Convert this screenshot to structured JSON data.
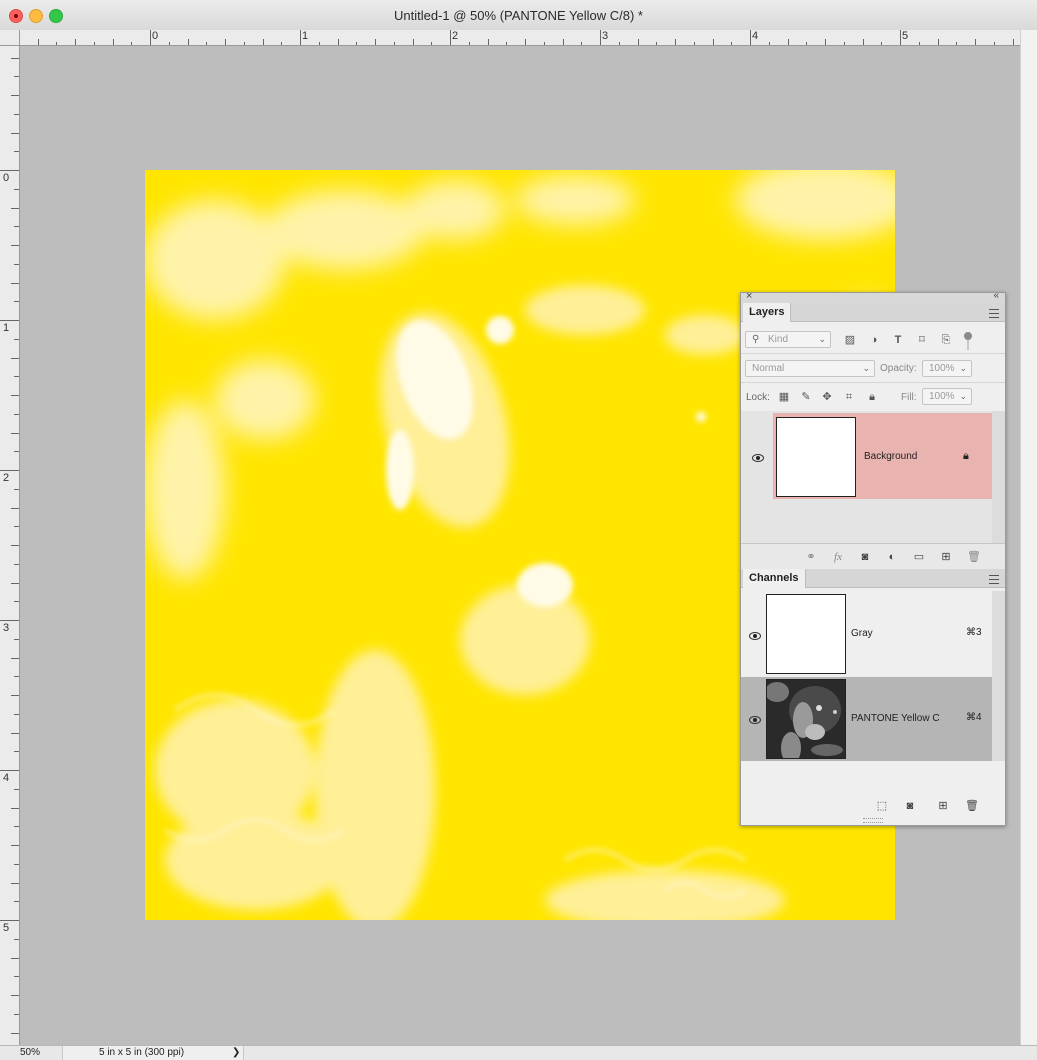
{
  "window": {
    "title": "Untitled-1 @ 50% (PANTONE Yellow C/8) *"
  },
  "rulers": {
    "horizontal_labels": [
      "0",
      "1",
      "2",
      "3",
      "4",
      "5"
    ],
    "vertical_labels": [
      "0",
      "1",
      "2",
      "3",
      "4",
      "5"
    ]
  },
  "canvas": {
    "ink_color": "#ffe500",
    "paper_color": "#fff8d4"
  },
  "status_bar": {
    "zoom": "50%",
    "document_size": "5 in x 5 in (300 ppi)",
    "menu_arrow": "❯"
  },
  "layers_panel": {
    "tab_label": "Layers",
    "filter_kind": "Kind",
    "blend_mode": "Normal",
    "opacity_label": "Opacity:",
    "opacity_value": "100%",
    "lock_label": "Lock:",
    "fill_label": "Fill:",
    "fill_value": "100%",
    "layers": [
      {
        "name": "Background",
        "visible": true,
        "locked": true,
        "selected": true
      }
    ],
    "footer_icons": [
      "link-icon",
      "fx-icon",
      "mask-icon",
      "adjustment-icon",
      "folder-icon",
      "new-layer-icon",
      "trash-icon"
    ],
    "fx_label": "fx"
  },
  "channels_panel": {
    "tab_label": "Channels",
    "channels": [
      {
        "name": "Gray",
        "shortcut": "⌘3",
        "visible": true,
        "selected": false
      },
      {
        "name": "PANTONE Yellow C",
        "shortcut": "⌘4",
        "visible": true,
        "selected": true
      }
    ],
    "footer_icons": [
      "selection-icon",
      "mask-icon",
      "new-channel-icon",
      "trash-icon"
    ]
  },
  "colors": {
    "selected_layer_bg": "#e9b4b0",
    "selected_channel_bg": "#b5b5b5",
    "canvas_backdrop": "#bdbdbd"
  }
}
